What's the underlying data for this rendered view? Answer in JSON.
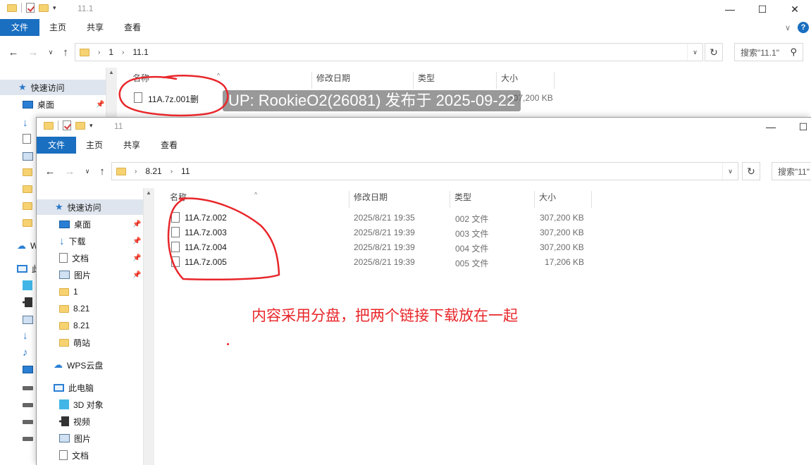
{
  "back_window": {
    "title": "11.1",
    "ribbon_tabs": [
      "文件",
      "主页",
      "共享",
      "查看"
    ],
    "breadcrumb": [
      "1",
      "11.1"
    ],
    "search_placeholder": "搜索\"11.1\"",
    "nav": {
      "quick_access": "快速访问",
      "desktop": "桌面",
      "wps_cloud_partial": "W",
      "this_pc_partial": "此"
    },
    "columns": [
      "名称",
      "修改日期",
      "类型",
      "大小"
    ],
    "files": [
      {
        "name": "11A.7z.001删",
        "size": "307,200 KB"
      }
    ]
  },
  "watermark": "UP: RookieO2(26081) 发布于 2025-09-22",
  "front_window": {
    "title": "11",
    "ribbon_tabs": [
      "文件",
      "主页",
      "共享",
      "查看"
    ],
    "breadcrumb": [
      "8.21",
      "11"
    ],
    "search_placeholder": "搜索\"11\"",
    "nav_items": {
      "quick_access": "快速访问",
      "desktop": "桌面",
      "downloads": "下载",
      "documents": "文档",
      "pictures": "图片",
      "folder_1": "1",
      "folder_821a": "8.21",
      "folder_821b": "8.21",
      "folder_mengzhan": "萌站",
      "wps_cloud": "WPS云盘",
      "this_pc": "此电脑",
      "objects_3d": "3D 对象",
      "videos": "视频",
      "pictures_pc": "图片",
      "documents_pc": "文档"
    },
    "columns": [
      "名称",
      "修改日期",
      "类型",
      "大小"
    ],
    "files": [
      {
        "name": "11A.7z.002",
        "date": "2025/8/21 19:35",
        "type": "002 文件",
        "size": "307,200 KB"
      },
      {
        "name": "11A.7z.003",
        "date": "2025/8/21 19:39",
        "type": "003 文件",
        "size": "307,200 KB"
      },
      {
        "name": "11A.7z.004",
        "date": "2025/8/21 19:39",
        "type": "004 文件",
        "size": "307,200 KB"
      },
      {
        "name": "11A.7z.005",
        "date": "2025/8/21 19:39",
        "type": "005 文件",
        "size": "17,206 KB"
      }
    ]
  },
  "annotation": "内容采用分盘，把两个链接下载放在一起",
  "colors": {
    "accent": "#1a6fc0",
    "annotation": "#e8262a",
    "selected_nav": "#dfe5ee"
  }
}
